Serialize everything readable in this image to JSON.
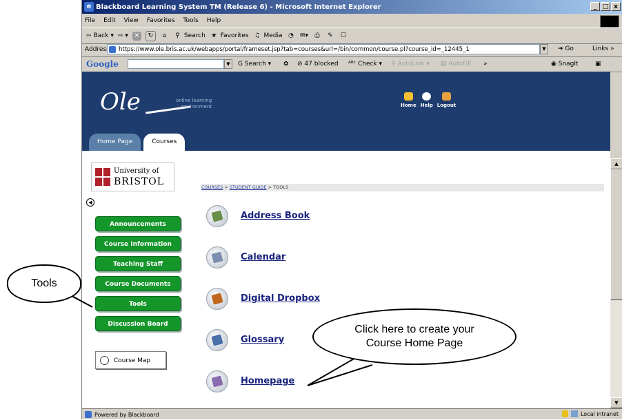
{
  "window": {
    "title": "Blackboard Learning System TM (Release 6) - Microsoft Internet Explorer",
    "controls": [
      "_",
      "□",
      "x"
    ]
  },
  "menu": [
    "File",
    "Edit",
    "View",
    "Favorites",
    "Tools",
    "Help"
  ],
  "toolbar": {
    "back": "Back",
    "search": "Search",
    "favorites": "Favorites",
    "media": "Media"
  },
  "address": {
    "label": "Address",
    "url": "https://www.ole.bris.ac.uk/webapps/portal/frameset.jsp?tab=courses&url=/bin/common/course.pl?course_id=_12445_1",
    "go": "Go",
    "links": "Links »"
  },
  "google_bar": {
    "logo": "Google",
    "search": "Search",
    "blocked": "47 blocked",
    "check": "Check",
    "autolink": "AutoLink",
    "autofill": "AutoFill",
    "more": "»",
    "snagit": "SnagIt"
  },
  "site": {
    "logo_text": "Ole",
    "logo_sub_1": "online learning",
    "logo_sub_2": "environment",
    "top_links": [
      "Home",
      "Help",
      "Logout"
    ],
    "tabs": [
      "Home Page",
      "Courses"
    ],
    "university_1": "University of",
    "university_2": "BRISTOL"
  },
  "breadcrumb": {
    "courses": "COURSES",
    "student_guide": "STUDENT GUIDE",
    "current": "TOOLS",
    "sep": " > "
  },
  "nav": {
    "collapse": "◀",
    "items": [
      "Announcements",
      "Course Information",
      "Teaching Staff",
      "Course Documents",
      "Tools",
      "Discussion Board"
    ],
    "course_map": "Course Map"
  },
  "tools": [
    {
      "label": "Address Book",
      "color": "#6a8f4a"
    },
    {
      "label": "Calendar",
      "color": "#7d8fb0"
    },
    {
      "label": "Digital Dropbox",
      "color": "#c2661e"
    },
    {
      "label": "Glossary",
      "color": "#4b6fa8"
    },
    {
      "label": "Homepage",
      "color": "#8a6db0"
    }
  ],
  "status": {
    "left": "Powered by Blackboard",
    "zone": "Local intranet"
  },
  "callouts": {
    "tools": "Tools",
    "homepage": "Click here to create your Course Home Page"
  },
  "colors": {
    "banner": "#1f3c6e",
    "nav_button": "#15962a",
    "link": "#1a237e"
  }
}
